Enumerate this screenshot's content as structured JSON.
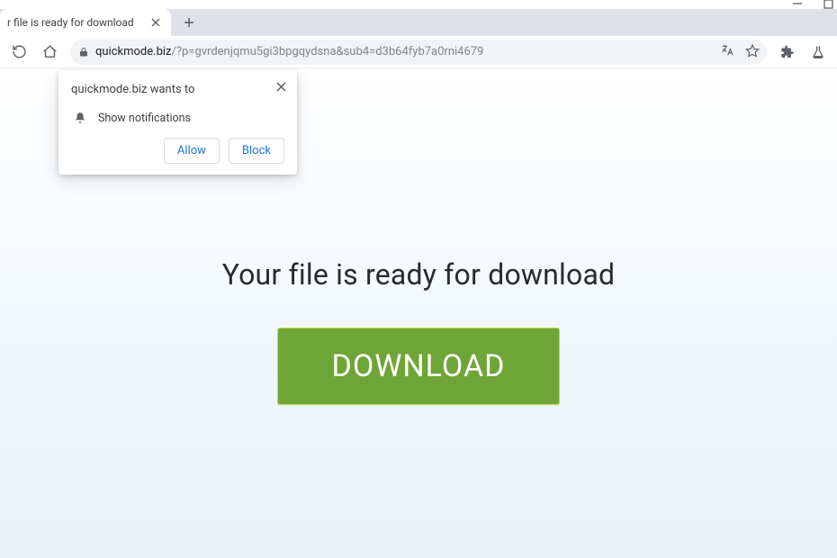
{
  "window": {
    "controls": {
      "minimize": "minimize",
      "maximize": "maximize"
    }
  },
  "tab": {
    "title": "r file is ready for download"
  },
  "toolbar": {
    "url_domain": "quickmode.biz",
    "url_path": "/?p=gvrdenjqmu5gi3bpgqydsna&sub4=d3b64fyb7a0rni4679"
  },
  "permission_popup": {
    "title": "quickmode.biz wants to",
    "item": "Show notifications",
    "allow_label": "Allow",
    "block_label": "Block"
  },
  "page": {
    "headline": "Your file is ready for download",
    "download_label": "DOWNLOAD"
  }
}
